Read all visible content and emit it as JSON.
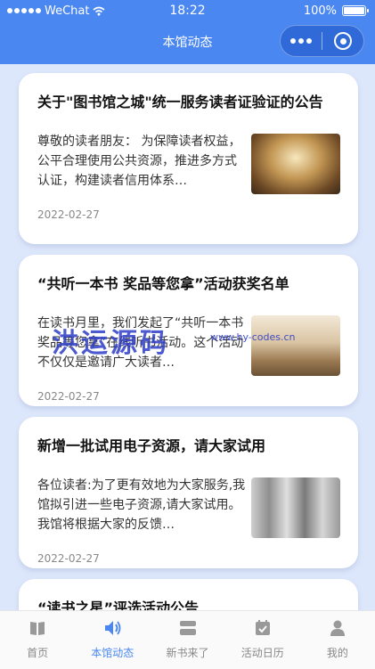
{
  "status_bar": {
    "carrier": "WeChat",
    "time": "18:22",
    "battery": "100%",
    "battery_level": 1.0
  },
  "nav": {
    "title": "本馆动态"
  },
  "cards": [
    {
      "title": "关于\"图书馆之城\"统一服务读者证验证的公告",
      "desc": "尊敬的读者朋友： 为保障读者权益，公平合理使用公共资源，推进多方式认证，构建读者信用体系…",
      "date": "2022-02-27"
    },
    {
      "title": "“共听一本书 奖品等您拿”活动获奖名单",
      "desc": "在读书月里，我们发起了“共听一本书 奖品等您拿”在线听书活动。这个活动不仅仅是邀请广大读者…",
      "date": "2022-02-27"
    },
    {
      "title": "新增一批试用电子资源，请大家试用",
      "desc": "各位读者:为了更有效地为大家服务,我馆拟引进一些电子资源,请大家试用。我馆将根据大家的反馈…",
      "date": "2022-02-27"
    },
    {
      "title": "“读书之星”评选活动公告",
      "desc": "",
      "date": ""
    }
  ],
  "watermark": {
    "text": "洪运源码",
    "url": "www.hy-codes.cn"
  },
  "tabs": [
    {
      "label": "首页",
      "icon": "book-icon"
    },
    {
      "label": "本馆动态",
      "icon": "speaker-icon"
    },
    {
      "label": "新书来了",
      "icon": "books-stack-icon"
    },
    {
      "label": "活动日历",
      "icon": "calendar-icon"
    },
    {
      "label": "我的",
      "icon": "user-icon"
    }
  ],
  "colors": {
    "accent": "#4a87f0",
    "background": "#dde7fb"
  }
}
